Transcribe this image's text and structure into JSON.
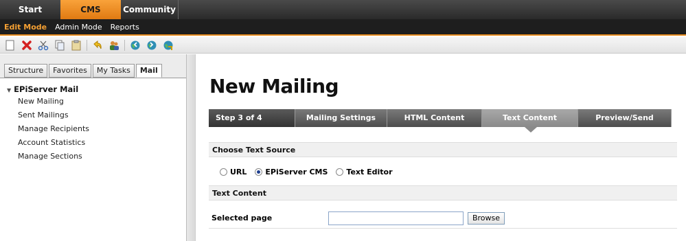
{
  "top_tabs": [
    "Start",
    "CMS",
    "Community"
  ],
  "modes": [
    "Edit Mode",
    "Admin Mode",
    "Reports"
  ],
  "toolbar_icons": [
    "new-page-icon",
    "delete-icon",
    "cut-icon",
    "copy-icon",
    "paste-icon",
    "undo-icon",
    "users-icon",
    "globe-back-icon",
    "globe-forward-icon",
    "globe-refresh-icon"
  ],
  "left_tabs": [
    "Structure",
    "Favorites",
    "My Tasks",
    "Mail"
  ],
  "tree": {
    "root": "EPiServer Mail",
    "items": [
      "New Mailing",
      "Sent Mailings",
      "Manage Recipients",
      "Account Statistics",
      "Manage Sections"
    ]
  },
  "main": {
    "title": "New Mailing",
    "steps": [
      "Step 3 of 4",
      "Mailing Settings",
      "HTML Content",
      "Text Content",
      "Preview/Send"
    ],
    "choose_source_label": "Choose Text Source",
    "radio_options": [
      "URL",
      "EPiServer CMS",
      "Text Editor"
    ],
    "selected_radio": "EPiServer CMS",
    "text_content_label": "Text Content",
    "selected_page_label": "Selected page",
    "selected_page_value": "",
    "browse_label": "Browse"
  },
  "colors": {
    "accent": "#e88c1f",
    "topbar": "#2a2a2a",
    "active_step": "#8a8a8a"
  }
}
